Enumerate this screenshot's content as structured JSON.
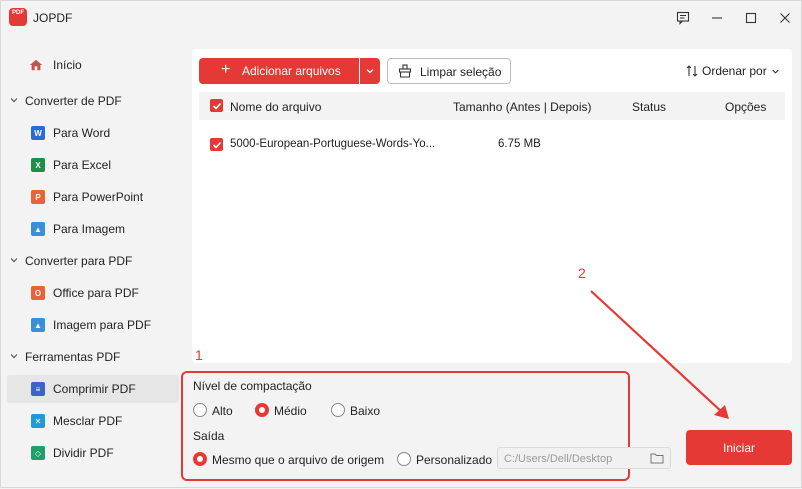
{
  "app": {
    "title": "JOPDF",
    "logo_text": "PDF"
  },
  "sidebar": {
    "home": "Início",
    "sections": [
      {
        "label": "Converter de PDF",
        "items": [
          {
            "label": "Para Word",
            "icon": "word-icon",
            "color": "#2b6cd4",
            "glyph": "W"
          },
          {
            "label": "Para Excel",
            "icon": "excel-icon",
            "color": "#1e8e4a",
            "glyph": "X"
          },
          {
            "label": "Para PowerPoint",
            "icon": "powerpoint-icon",
            "color": "#e8623a",
            "glyph": "P"
          },
          {
            "label": "Para Imagem",
            "icon": "image-icon",
            "color": "#3a8fd8",
            "glyph": "▲"
          }
        ]
      },
      {
        "label": "Converter para PDF",
        "items": [
          {
            "label": "Office para PDF",
            "icon": "office-icon",
            "color": "#e8623a",
            "glyph": "O"
          },
          {
            "label": "Imagem para PDF",
            "icon": "image-to-pdf-icon",
            "color": "#3a8fd8",
            "glyph": "▲"
          }
        ]
      },
      {
        "label": "Ferramentas PDF",
        "items": [
          {
            "label": "Comprimir PDF",
            "icon": "compress-icon",
            "color": "#3d63c9",
            "glyph": "≡"
          },
          {
            "label": "Mesclar PDF",
            "icon": "merge-icon",
            "color": "#1f9ad6",
            "glyph": "✕"
          },
          {
            "label": "Dividir PDF",
            "icon": "split-icon",
            "color": "#1e9e6a",
            "glyph": "◇"
          }
        ]
      }
    ]
  },
  "toolbar": {
    "add_label": "Adicionar arquivos",
    "clear_label": "Limpar seleção",
    "sort_label": "Ordenar por"
  },
  "table": {
    "headers": [
      "Nome do arquivo",
      "Tamanho (Antes | Depois)",
      "Status",
      "Opções"
    ],
    "rows": [
      {
        "name": "5000-European-Portuguese-Words-Yo...",
        "size": "6.75 MB",
        "status": "",
        "options": ""
      }
    ]
  },
  "options": {
    "compression_title": "Nível de compactação",
    "levels": [
      "Alto",
      "Médio",
      "Baixo"
    ],
    "selected_level": "Médio",
    "output_title": "Saída",
    "outputs": [
      "Mesmo que o arquivo de origem",
      "Personalizado"
    ],
    "selected_output": "Mesmo que o arquivo de origem",
    "path_placeholder": "C:/Users/Dell/Desktop"
  },
  "annotations": {
    "one": "1",
    "two": "2"
  },
  "start_label": "Iniciar",
  "colors": {
    "accent": "#e53935"
  }
}
